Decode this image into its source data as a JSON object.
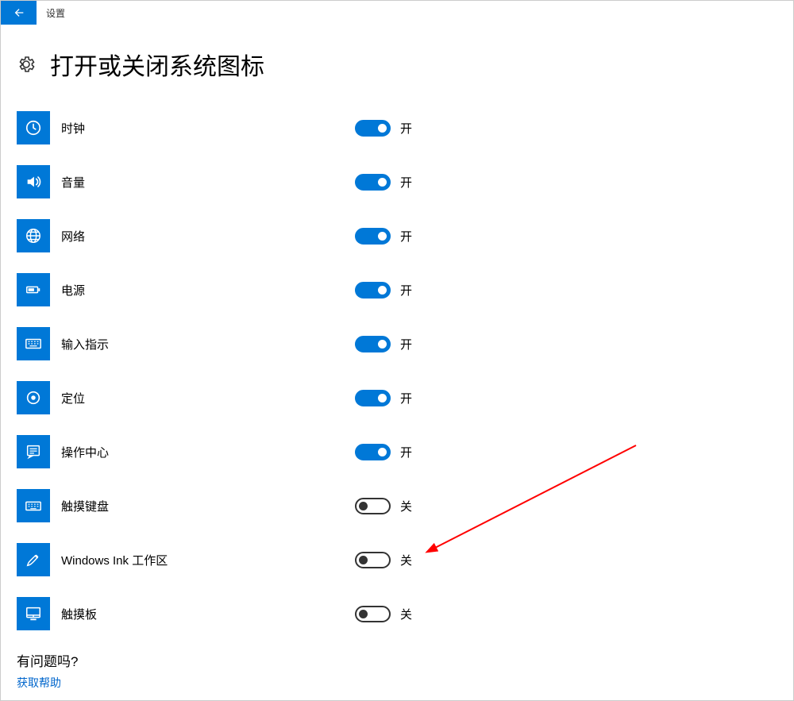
{
  "titlebar": {
    "title": "设置"
  },
  "page": {
    "heading": "打开或关闭系统图标"
  },
  "labels": {
    "on": "开",
    "off": "关"
  },
  "items": [
    {
      "key": "clock",
      "icon": "clock-icon",
      "label": "时钟",
      "state": "on"
    },
    {
      "key": "volume",
      "icon": "volume-icon",
      "label": "音量",
      "state": "on"
    },
    {
      "key": "network",
      "icon": "network-icon",
      "label": "网络",
      "state": "on"
    },
    {
      "key": "power",
      "icon": "power-icon",
      "label": "电源",
      "state": "on"
    },
    {
      "key": "ime",
      "icon": "keyboard-icon",
      "label": "输入指示",
      "state": "on"
    },
    {
      "key": "location",
      "icon": "location-icon",
      "label": "定位",
      "state": "on"
    },
    {
      "key": "actioncenter",
      "icon": "action-center-icon",
      "label": "操作中心",
      "state": "on"
    },
    {
      "key": "touchkb",
      "icon": "touch-keyboard-icon",
      "label": "触摸键盘",
      "state": "off"
    },
    {
      "key": "ink",
      "icon": "ink-icon",
      "label": "Windows Ink 工作区",
      "state": "off"
    },
    {
      "key": "touchpad",
      "icon": "touchpad-icon",
      "label": "触摸板",
      "state": "off"
    }
  ],
  "footer": {
    "question": "有问题吗?",
    "help_link": "获取帮助"
  }
}
